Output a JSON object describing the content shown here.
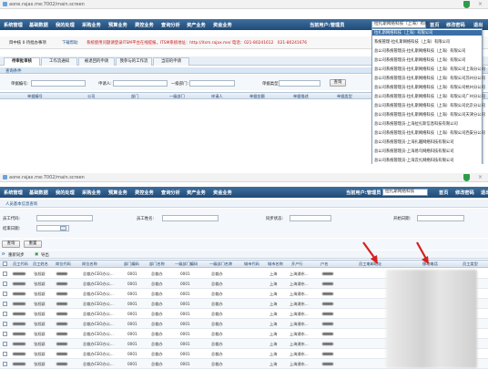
{
  "top": {
    "address_url": "aone.rajax.me:7002/main.screen",
    "nav_items": [
      "系统管理",
      "基础数据",
      "我的处理",
      "采购业务",
      "预算业务",
      "费控业务",
      "查询分析",
      "资产业务",
      "资金业务"
    ],
    "user_label": "当前用户:管理员",
    "org_selected": "拉扎斯网络科技（上海）有限公司",
    "right_links": [
      "首页",
      "修改密码",
      "退出"
    ],
    "notice_left": "目中核 0 待批办事项",
    "notice_link": "下载帮助",
    "notice_red": "系统使用问题请登录ITSM平台在线提报，ITSM系统地址：http://itsm.rajax.me/ 电话：021-80241612　021-80241676",
    "tabs": [
      "待审批审核",
      "工作流通知",
      "被退回的申请",
      "我参与的工作流",
      "当前的申请"
    ],
    "section_title": "查询条件",
    "form_labels": [
      "单据编号:",
      "申请人:",
      "一级部门:",
      "单据类型:"
    ],
    "query_button": "查询",
    "grid_headers": [
      "单据编号",
      "公司",
      "部门",
      "一级部门",
      "申请人",
      "单据金额",
      "单据描述",
      "单据类型"
    ],
    "dropdown_options": [
      "拉扎斯网络科技（上海）有限公司",
      "系统管理-拉扎斯网络科技（上海）有限公司",
      "总公司系统管理员-拉扎斯网络科技（上海）有限公司",
      "总公司系统管理员-拉扎斯网络科技（上海）有限公司",
      "总公司系统管理员-拉扎斯网络科技（上海）有限公司上海分公司",
      "总公司系统管理员-拉扎斯网络科技（上海）有限公司苏州分公司",
      "总公司系统管理员-拉扎斯网络科技（上海）有限公司杭州分公司",
      "总公司系统管理员-拉扎斯网络科技（上海）有限公司广州分公司",
      "总公司系统管理员-拉扎斯网络科技（上海）有限公司北京分公司",
      "总公司系统管理员-拉扎斯网络科技（上海）有限公司天津分公司",
      "总公司系统管理员-上海拉扎斯信息科技有限公司",
      "总公司系统管理员-拉扎斯网络科技（上海）有限公司西安分公司",
      "总公司系统管理员-上海扎趣网络科技有限公司",
      "总公司系统管理员-上海易鸟网络科技有限公司",
      "总公司系统管理员-上海云扎网络科技有限公司"
    ]
  },
  "bottom": {
    "address_url": "aone.rajax.me:7002/main.screen",
    "nav_items": [
      "系统管理",
      "基础数据",
      "我的处理",
      "采购业务",
      "预算业务",
      "费控业务",
      "查询分析",
      "资产业务",
      "资金业务"
    ],
    "user_label": "当前用户:管理员",
    "org_selected": "拉扎斯网络科技",
    "right_links": [
      "首页",
      "修改密码",
      "退出"
    ],
    "section_title": "人员基本信息查询",
    "form_labels": [
      "员工代码:",
      "员工姓名:",
      "同步状态:",
      "开始日期:",
      "结束日期:"
    ],
    "buttons": [
      "查询",
      "重置"
    ],
    "tool_items": [
      "重新同步",
      "导出"
    ],
    "grid_headers": [
      "员工代码",
      "员工姓名",
      "岗位代码",
      "岗位名称",
      "部门编码",
      "部门名称",
      "一级部门编码",
      "一级部门名称",
      "城市代码",
      "城市名称",
      "开户行",
      "户名",
      "员工电邮地址",
      "移动电话",
      "员工类型"
    ],
    "rows": [
      {
        "name": "张旭颖",
        "dept": "总裁办CEO办公...",
        "code": "0001",
        "dname": "总裁办",
        "l1code": "0001",
        "l1name": "总裁办",
        "city": "上海",
        "bank": "上海浦东..."
      },
      {
        "name": "张旭颖",
        "dept": "总裁办CEO办公...",
        "code": "0001",
        "dname": "总裁办",
        "l1code": "0001",
        "l1name": "总裁办",
        "city": "上海",
        "bank": "上海浦东..."
      },
      {
        "name": "张旭颖",
        "dept": "总裁办CEO办公...",
        "code": "0001",
        "dname": "总裁办",
        "l1code": "0001",
        "l1name": "总裁办",
        "city": "上海",
        "bank": "上海浦东..."
      },
      {
        "name": "张旭颖",
        "dept": "总裁办CEO办公...",
        "code": "0001",
        "dname": "总裁办",
        "l1code": "0001",
        "l1name": "总裁办",
        "city": "上海",
        "bank": "上海浦东..."
      },
      {
        "name": "张旭颖",
        "dept": "总裁办CEO办公...",
        "code": "0001",
        "dname": "总裁办",
        "l1code": "0001",
        "l1name": "总裁办",
        "city": "上海",
        "bank": "上海浦东..."
      },
      {
        "name": "张旭颖",
        "dept": "总裁办CEO办公...",
        "code": "0001",
        "dname": "总裁办",
        "l1code": "0001",
        "l1name": "总裁办",
        "city": "上海",
        "bank": "上海浦东..."
      },
      {
        "name": "张旭颖",
        "dept": "总裁办CEO办公...",
        "code": "0001",
        "dname": "总裁办",
        "l1code": "0001",
        "l1name": "总裁办",
        "city": "上海",
        "bank": "上海浦东..."
      },
      {
        "name": "张旭颖",
        "dept": "总裁办CEO办公...",
        "code": "0001",
        "dname": "总裁办",
        "l1code": "0001",
        "l1name": "总裁办",
        "city": "上海",
        "bank": "上海浦东..."
      },
      {
        "name": "张旭颖",
        "dept": "总裁办CEO办公...",
        "code": "0001",
        "dname": "总裁办",
        "l1code": "0001",
        "l1name": "总裁办",
        "city": "上海",
        "bank": "上海浦东..."
      },
      {
        "name": "张旭颖",
        "dept": "总裁办CEO办公...",
        "code": "0001",
        "dname": "总裁办",
        "l1code": "0001",
        "l1name": "总裁办",
        "city": "上海",
        "bank": "上海浦东..."
      }
    ]
  },
  "colors": {
    "nav_bg": "#2b5a8a",
    "arrow_red": "#d42020",
    "notice_red": "#c81919"
  }
}
